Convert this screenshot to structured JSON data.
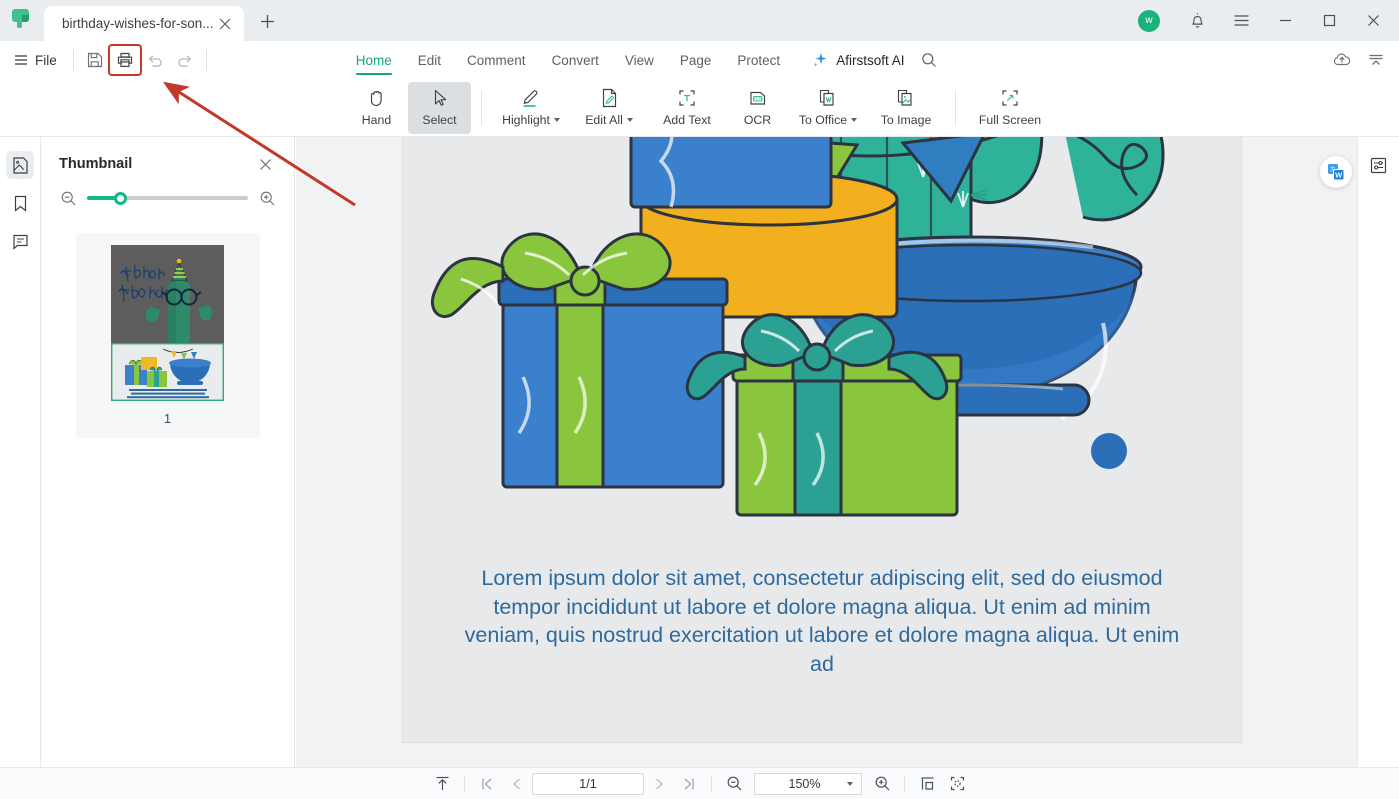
{
  "window": {
    "tab_title": "birthday-wishes-for-son...",
    "logo_icon": "afirstsoft-logo-icon",
    "new_tab_icon": "plus-icon",
    "tab_close_icon": "close-icon",
    "avatar_initial": "w",
    "notification_icon": "bell-icon",
    "app_menu_icon": "hamburger-icon",
    "minimize_icon": "minimize-icon",
    "maximize_icon": "maximize-icon",
    "close_icon": "close-icon"
  },
  "menubar": {
    "file_label": "File",
    "file_icon": "hamburger-icon",
    "quick_actions": [
      {
        "name": "save-button",
        "icon": "save-icon",
        "highlighted": false
      },
      {
        "name": "print-button",
        "icon": "print-icon",
        "highlighted": true
      },
      {
        "name": "undo-button",
        "icon": "undo-icon",
        "highlighted": false
      },
      {
        "name": "redo-button",
        "icon": "redo-icon",
        "highlighted": false
      }
    ],
    "tabs": [
      {
        "label": "Home",
        "active": true
      },
      {
        "label": "Edit",
        "active": false
      },
      {
        "label": "Comment",
        "active": false
      },
      {
        "label": "Convert",
        "active": false
      },
      {
        "label": "View",
        "active": false
      },
      {
        "label": "Page",
        "active": false
      },
      {
        "label": "Protect",
        "active": false
      }
    ],
    "ai_label": "Afirstsoft AI",
    "ai_icon": "sparkle-icon",
    "search_icon": "search-icon",
    "cloud_icon": "cloud-upload-icon",
    "collapse_icon": "collapse-ribbon-icon",
    "accent_color": "#17a673"
  },
  "ribbon": {
    "items": [
      {
        "label": "Hand",
        "icon": "hand-icon",
        "selected": false,
        "dropdown": false
      },
      {
        "label": "Select",
        "icon": "cursor-arrow-icon",
        "selected": true,
        "dropdown": false
      },
      {
        "label": "Highlight",
        "icon": "highlighter-icon",
        "selected": false,
        "dropdown": true
      },
      {
        "label": "Edit All",
        "icon": "edit-document-icon",
        "selected": false,
        "dropdown": true
      },
      {
        "label": "Add Text",
        "icon": "add-text-icon",
        "selected": false,
        "dropdown": false
      },
      {
        "label": "OCR",
        "icon": "ocr-icon",
        "selected": false,
        "dropdown": false
      },
      {
        "label": "To Office",
        "icon": "to-word-icon",
        "selected": false,
        "dropdown": true
      },
      {
        "label": "To Image",
        "icon": "to-image-icon",
        "selected": false,
        "dropdown": false
      },
      {
        "label": "Full Screen",
        "icon": "fullscreen-icon",
        "selected": false,
        "dropdown": false
      }
    ]
  },
  "left_rail": {
    "items": [
      {
        "name": "sidebar-item-thumbnail",
        "icon": "thumbnail-page-icon",
        "active": true
      },
      {
        "name": "sidebar-item-bookmark",
        "icon": "bookmark-icon",
        "active": false
      },
      {
        "name": "sidebar-item-comment",
        "icon": "comment-icon",
        "active": false
      }
    ]
  },
  "thumbnail_panel": {
    "title": "Thumbnail",
    "close_icon": "close-icon",
    "zoom_out_icon": "zoom-out-icon",
    "zoom_in_icon": "zoom-in-icon",
    "slider_value": 17,
    "page_number": "1"
  },
  "viewer": {
    "translate_icon": "translate-to-word-icon",
    "right_panel_icon": "properties-sliders-icon",
    "document_text": "Lorem ipsum dolor sit amet, consectetur adipiscing elit, sed do eiusmod tempor incididunt ut labore et dolore magna aliqua. Ut enim ad minim veniam, quis nostrud exercitation ut labore et dolore magna aliqua. Ut enim ad",
    "document_text_color": "#2f6a9e",
    "page_background": "#e7e9ea"
  },
  "statusbar": {
    "scroll_top_icon": "scroll-to-top-icon",
    "first_page_icon": "first-page-icon",
    "prev_page_icon": "prev-page-icon",
    "page_indicator": "1/1",
    "next_page_icon": "next-page-icon",
    "last_page_icon": "last-page-icon",
    "zoom_out_icon": "zoom-out-icon",
    "zoom_level": "150%",
    "zoom_dropdown_icon": "chevron-down-icon",
    "zoom_in_icon": "zoom-in-icon",
    "fit_width_icon": "fit-width-icon",
    "fit_page_icon": "fit-page-icon"
  },
  "annotation": {
    "arrow_color": "#c0392b",
    "highlight_box_color": "#c0392b"
  }
}
